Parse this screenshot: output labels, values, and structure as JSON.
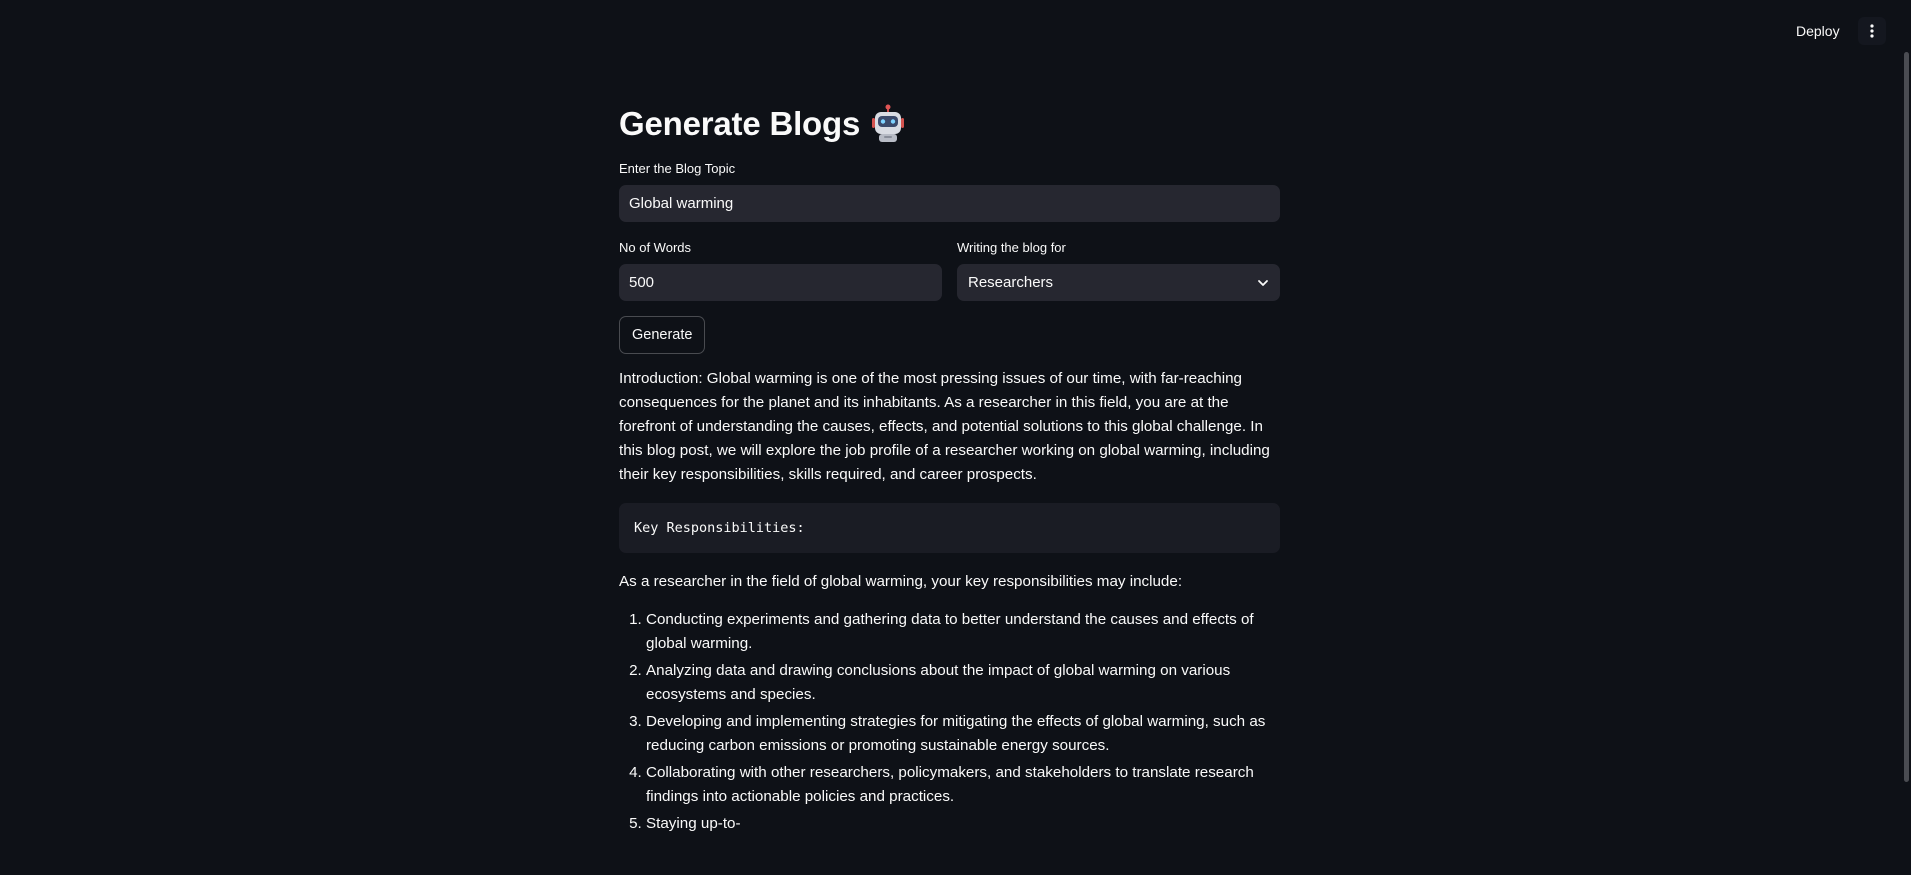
{
  "header": {
    "deploy_label": "Deploy",
    "menu_icon": "vertical-dots-icon"
  },
  "page": {
    "title": "Generate Blogs",
    "title_emoji": "robot-icon"
  },
  "form": {
    "topic_label": "Enter the Blog Topic",
    "topic_value": "Global warming",
    "words_label": "No of Words",
    "words_value": "500",
    "audience_label": "Writing the blog for",
    "audience_selected": "Researchers",
    "generate_label": "Generate"
  },
  "blog": {
    "intro": "Introduction: Global warming is one of the most pressing issues of our time, with far-reaching consequences for the planet and its inhabitants. As a researcher in this field, you are at the forefront of understanding the causes, effects, and potential solutions to this global challenge. In this blog post, we will explore the job profile of a researcher working on global warming, including their key responsibilities, skills required, and career prospects.",
    "code_heading": "Key Responsibilities:",
    "responsibilities_intro": "As a researcher in the field of global warming, your key responsibilities may include:",
    "items": [
      "Conducting experiments and gathering data to better understand the causes and effects of global warming.",
      "Analyzing data and drawing conclusions about the impact of global warming on various ecosystems and species.",
      "Developing and implementing strategies for mitigating the effects of global warming, such as reducing carbon emissions or promoting sustainable energy sources.",
      "Collaborating with other researchers, policymakers, and stakeholders to translate research findings into actionable policies and practices.",
      "Staying up-to-"
    ]
  },
  "colors": {
    "background": "#0e1117",
    "input_bg": "#262730",
    "code_bg": "#1a1c24",
    "text": "#fafafa"
  }
}
